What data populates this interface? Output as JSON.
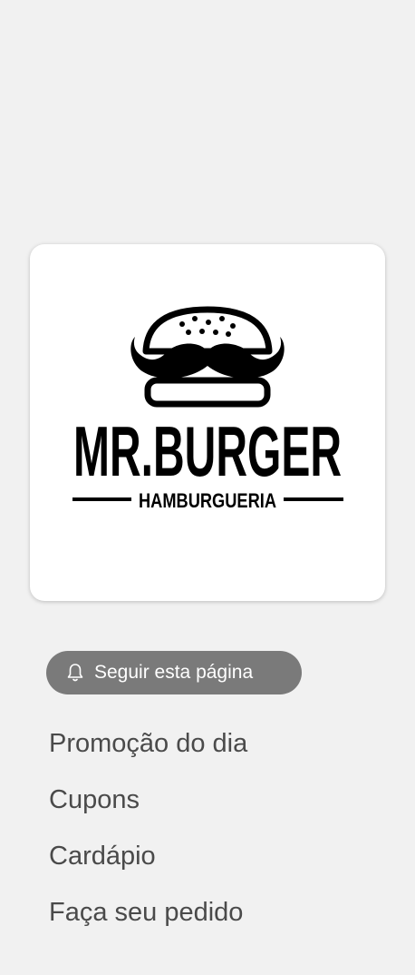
{
  "logo": {
    "brand_name": "MR.BURGER",
    "brand_subtitle": "HAMBURGUERIA"
  },
  "follow_button": {
    "icon": "bell-icon",
    "label": "Seguir esta página"
  },
  "menu": {
    "items": [
      {
        "label": "Promoção do dia"
      },
      {
        "label": "Cupons"
      },
      {
        "label": "Cardápio"
      },
      {
        "label": "Faça seu pedido"
      }
    ]
  },
  "colors": {
    "background": "#f1f1f1",
    "card": "#ffffff",
    "button": "#7a7a7a",
    "menu_text": "#4a4a4a"
  }
}
